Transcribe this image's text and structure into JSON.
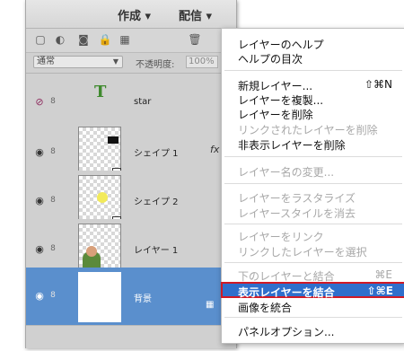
{
  "header": {
    "menu_create": "作成",
    "menu_share": "配信"
  },
  "toolbar": {
    "flyout_icon": "chevron-down-icon"
  },
  "options": {
    "blend_mode": "通常",
    "opacity_label": "不透明度:",
    "opacity_value": "100%"
  },
  "layers": [
    {
      "name": "star",
      "type": "text",
      "visible": false
    },
    {
      "name": "シェイプ 1",
      "type": "shape",
      "fx": "fx"
    },
    {
      "name": "シェイプ 2",
      "type": "shape"
    },
    {
      "name": "レイヤー 1",
      "type": "image"
    },
    {
      "name": "背景",
      "type": "background",
      "selected": true
    }
  ],
  "menu": {
    "layer_help": "レイヤーのヘルプ",
    "help_toc": "ヘルプの目次",
    "new_layer": "新規レイヤー...",
    "new_layer_shortcut": "⇧⌘N",
    "duplicate_layer": "レイヤーを複製...",
    "delete_layer": "レイヤーを削除",
    "delete_linked": "リンクされたレイヤーを削除",
    "delete_hidden": "非表示レイヤーを削除",
    "rename_layer": "レイヤー名の変更...",
    "rasterize_layer": "レイヤーをラスタライズ",
    "clear_layer_style": "レイヤースタイルを消去",
    "link_layers": "レイヤーをリンク",
    "select_linked": "リンクしたレイヤーを選択",
    "merge_down": "下のレイヤーと結合",
    "merge_down_shortcut": "⌘E",
    "merge_visible": "表示レイヤーを結合",
    "merge_visible_shortcut": "⇧⌘E",
    "flatten_image": "画像を統合",
    "panel_options": "パネルオプション..."
  }
}
